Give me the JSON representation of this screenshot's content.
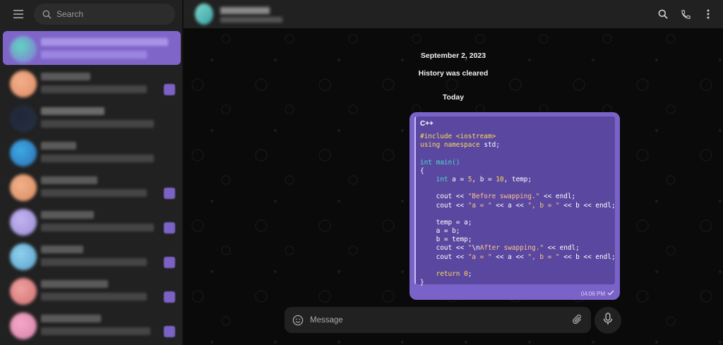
{
  "sidebar": {
    "search_placeholder": "Search",
    "menu_icon": "hamburger-menu-icon",
    "search_icon": "search-icon",
    "chats": [
      {
        "avatar_colors": [
          "#5fd6c0",
          "#8a6fd6"
        ],
        "line1_color": "#a893e6",
        "line2_color": "#9a86e0",
        "active": true,
        "badge": false
      },
      {
        "avatar_colors": [
          "#f1b08a",
          "#e08a64"
        ],
        "line1_color": "#5a5a5a",
        "line2_color": "#454545",
        "active": false,
        "badge": true
      },
      {
        "avatar_colors": [
          "#1e2636",
          "#283246"
        ],
        "line1_color": "#6a6a6a",
        "line2_color": "#454545",
        "active": false,
        "badge": false
      },
      {
        "avatar_colors": [
          "#3ea8e6",
          "#2a6fb0"
        ],
        "line1_color": "#5a5a5a",
        "line2_color": "#454545",
        "active": false,
        "badge": false
      },
      {
        "avatar_colors": [
          "#f1b08a",
          "#d98a60"
        ],
        "line1_color": "#5a5a5a",
        "line2_color": "#454545",
        "active": false,
        "badge": true
      },
      {
        "avatar_colors": [
          "#c2b4ef",
          "#9b8ad6"
        ],
        "line1_color": "#5a5a5a",
        "line2_color": "#454545",
        "active": false,
        "badge": true
      },
      {
        "avatar_colors": [
          "#8fd0ee",
          "#5aa0c8"
        ],
        "line1_color": "#5a5a5a",
        "line2_color": "#454545",
        "active": false,
        "badge": true
      },
      {
        "avatar_colors": [
          "#f0a0a0",
          "#d07070"
        ],
        "line1_color": "#5a5a5a",
        "line2_color": "#454545",
        "active": false,
        "badge": true
      },
      {
        "avatar_colors": [
          "#f4a8c8",
          "#d880a8"
        ],
        "line1_color": "#5a5a5a",
        "line2_color": "#454545",
        "active": false,
        "badge": true
      }
    ]
  },
  "header": {
    "search_icon": "search-icon",
    "call_icon": "phone-icon",
    "more_icon": "more-vertical-icon"
  },
  "messages": {
    "date_1": "September 2, 2023",
    "service_message": "History was cleared",
    "date_2": "Today",
    "code_language": "C++",
    "code_lines": [
      [
        [
          "pre",
          "#include <iostream>"
        ]
      ],
      [
        [
          "kw",
          "using namespace"
        ],
        [
          "",
          " std;"
        ]
      ],
      [
        [
          "",
          ""
        ]
      ],
      [
        [
          "type",
          "int"
        ],
        [
          "",
          " "
        ],
        [
          "fn",
          "main()"
        ]
      ],
      [
        [
          "",
          "{"
        ]
      ],
      [
        [
          "",
          "    "
        ],
        [
          "type",
          "int"
        ],
        [
          "",
          " a = "
        ],
        [
          "num",
          "5"
        ],
        [
          "",
          ", b = "
        ],
        [
          "num",
          "10"
        ],
        [
          "",
          ", temp;"
        ]
      ],
      [
        [
          "",
          ""
        ]
      ],
      [
        [
          "",
          "    cout << "
        ],
        [
          "str",
          "\"Before swapping.\""
        ],
        [
          "",
          " << endl;"
        ]
      ],
      [
        [
          "",
          "    cout << "
        ],
        [
          "str",
          "\"a = \""
        ],
        [
          "",
          " << a << "
        ],
        [
          "str",
          "\", b = \""
        ],
        [
          "",
          " << b << endl;"
        ]
      ],
      [
        [
          "",
          ""
        ]
      ],
      [
        [
          "",
          "    temp = a;"
        ]
      ],
      [
        [
          "",
          "    a = b;"
        ]
      ],
      [
        [
          "",
          "    b = temp;"
        ]
      ],
      [
        [
          "",
          "    cout << "
        ],
        [
          "str",
          "\""
        ],
        [
          "esc",
          "\\n"
        ],
        [
          "str",
          "After swapping.\""
        ],
        [
          "",
          " << endl;"
        ]
      ],
      [
        [
          "",
          "    cout << "
        ],
        [
          "str",
          "\"a = \""
        ],
        [
          "",
          " << a << "
        ],
        [
          "str",
          "\", b = \""
        ],
        [
          "",
          " << b << endl;"
        ]
      ],
      [
        [
          "",
          ""
        ]
      ],
      [
        [
          "",
          "    "
        ],
        [
          "kw",
          "return"
        ],
        [
          "",
          " "
        ],
        [
          "num",
          "0"
        ],
        [
          "",
          ";"
        ]
      ],
      [
        [
          "",
          "}"
        ]
      ]
    ],
    "time": "04:06 PM",
    "status_icon": "single-check-icon"
  },
  "composer": {
    "placeholder": "Message",
    "emoji_icon": "emoji-icon",
    "attach_icon": "paperclip-icon",
    "mic_icon": "microphone-icon"
  }
}
